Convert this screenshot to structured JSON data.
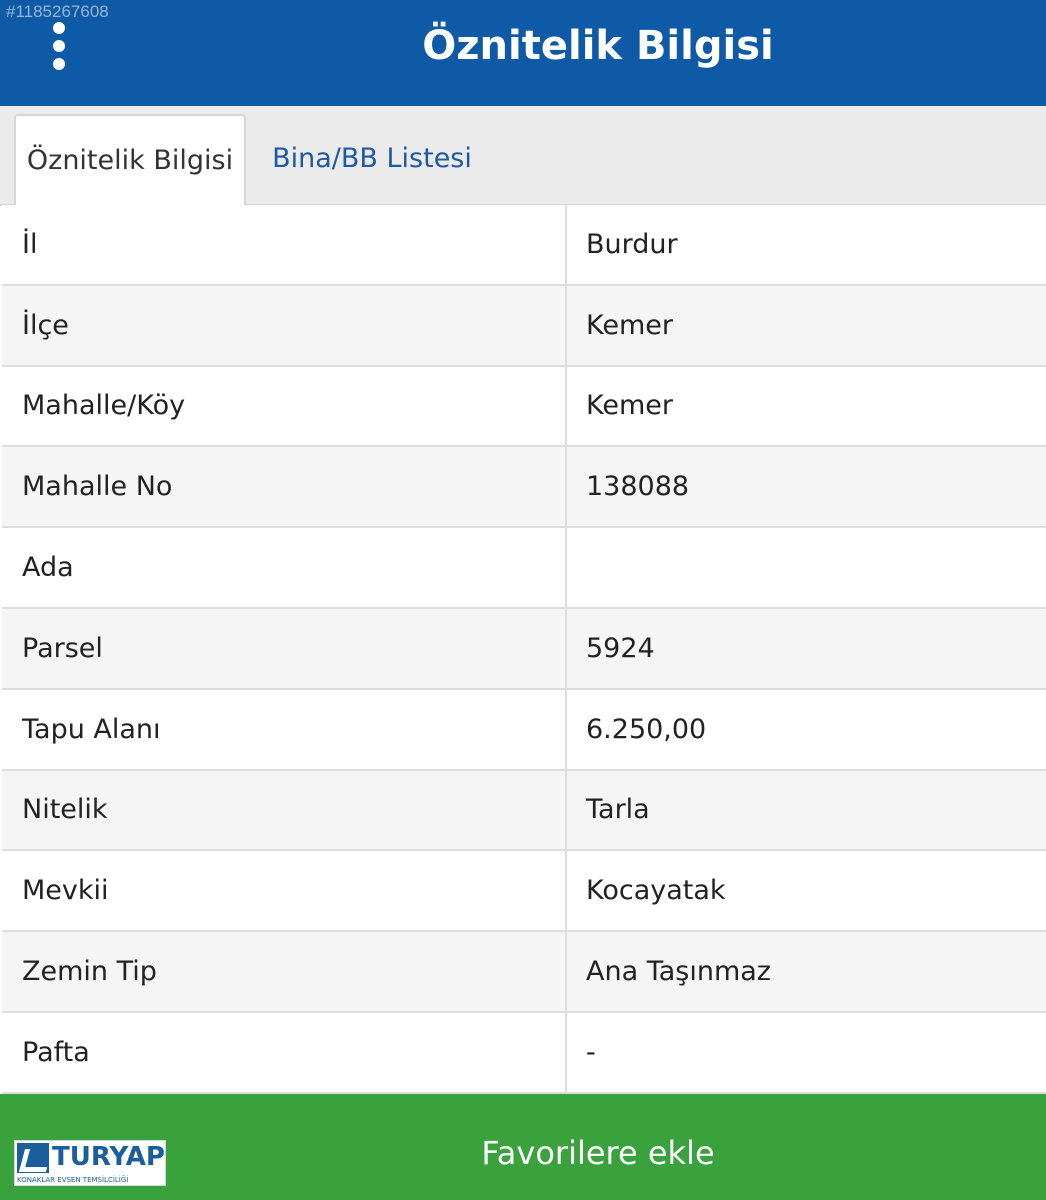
{
  "watermark": "#1185267608",
  "header": {
    "title": "Öznitelik Bilgisi"
  },
  "tabs": [
    {
      "label": "Öznitelik Bilgisi",
      "active": true
    },
    {
      "label": "Bina/BB Listesi",
      "active": false
    }
  ],
  "rows": [
    {
      "label": "İl",
      "value": "Burdur"
    },
    {
      "label": "İlçe",
      "value": "Kemer"
    },
    {
      "label": "Mahalle/Köy",
      "value": "Kemer"
    },
    {
      "label": "Mahalle No",
      "value": "138088"
    },
    {
      "label": "Ada",
      "value": ""
    },
    {
      "label": "Parsel",
      "value": "5924"
    },
    {
      "label": "Tapu Alanı",
      "value": "6.250,00"
    },
    {
      "label": "Nitelik",
      "value": "Tarla"
    },
    {
      "label": "Mevkii",
      "value": "Kocayatak"
    },
    {
      "label": "Zemin Tip",
      "value": "Ana Taşınmaz"
    },
    {
      "label": "Pafta",
      "value": "-"
    }
  ],
  "footer": {
    "button_label": "Favorilere ekle"
  },
  "logo": {
    "name": "TURYAP",
    "subtitle": "KONAKLAR EVSEN TEMSİLCİLİĞİ"
  },
  "colors": {
    "header": "#0e5aa7",
    "footer": "#3aa23c",
    "tab_link": "#1e5aa4"
  }
}
